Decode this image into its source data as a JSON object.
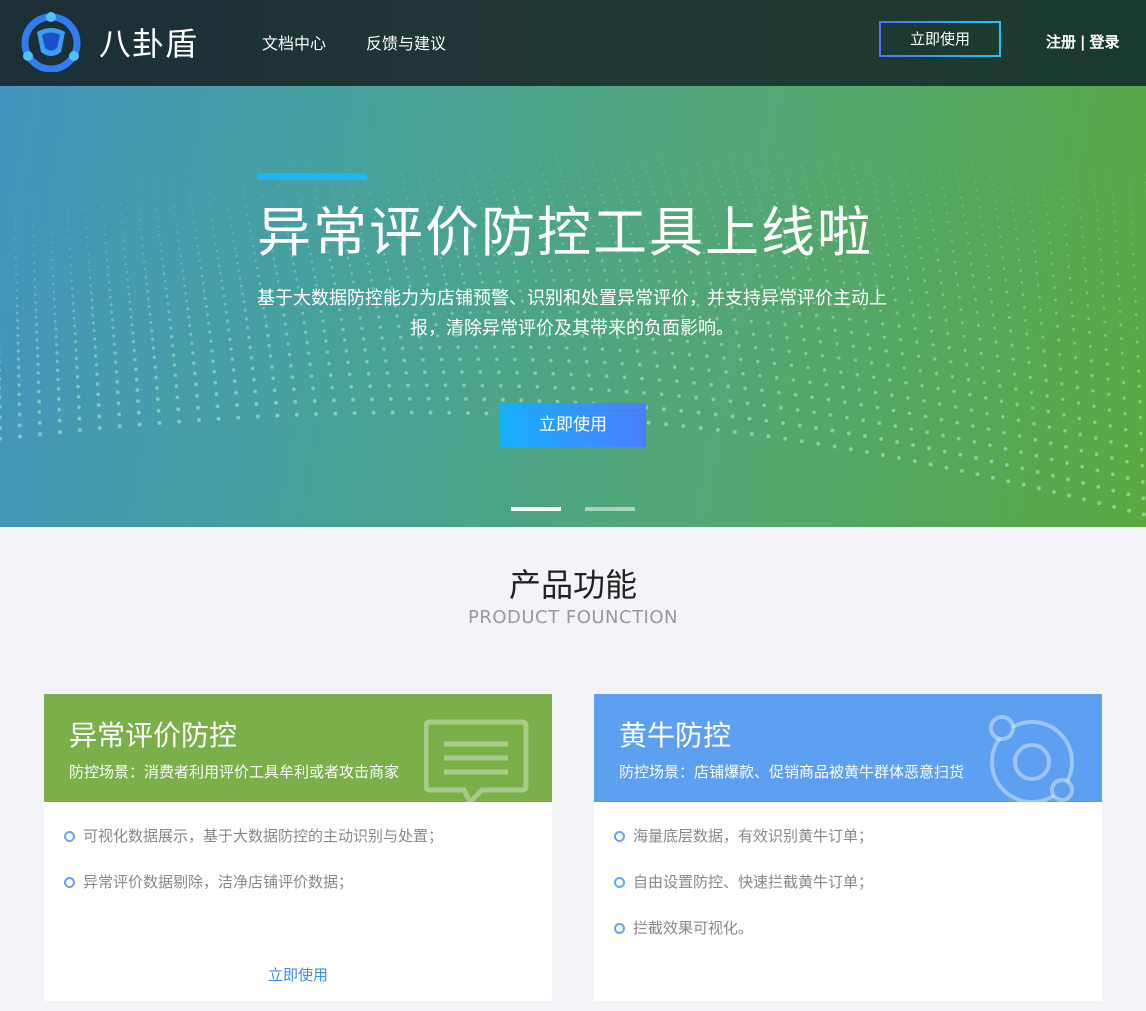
{
  "header": {
    "brand": "八卦盾",
    "nav": [
      "文档中心",
      "反馈与建议"
    ],
    "cta": "立即使用",
    "register": "注册",
    "separator": "|",
    "login": "登录"
  },
  "banner": {
    "title": "异常评价防控工具上线啦",
    "description": "基于大数据防控能力为店铺预警、识别和处置异常评价，并支持异常评价主动上报，清除异常评价及其带来的负面影响。",
    "cta": "立即使用",
    "slides": 2,
    "active_slide": 1
  },
  "section": {
    "title": "产品功能",
    "subtitle": "PRODUCT FOUNCTION"
  },
  "cards": [
    {
      "title": "异常评价防控",
      "scene": "防控场景：消费者利用评价工具牟利或者攻击商家",
      "items": [
        "可视化数据展示，基于大数据防控的主动识别与处置；",
        "异常评价数据剔除，洁净店铺评价数据；"
      ],
      "link": "立即使用",
      "color": "#79b04a",
      "icon": "comment-icon"
    },
    {
      "title": "黄牛防控",
      "scene": "防控场景：店铺爆款、促销商品被黄牛群体恶意扫货",
      "items": [
        "海量底层数据，有效识别黄牛订单；",
        "自由设置防控、快速拦截黄牛订单；",
        "拦截效果可视化。"
      ],
      "color": "#5d9ff0",
      "icon": "orbit-icon"
    }
  ]
}
